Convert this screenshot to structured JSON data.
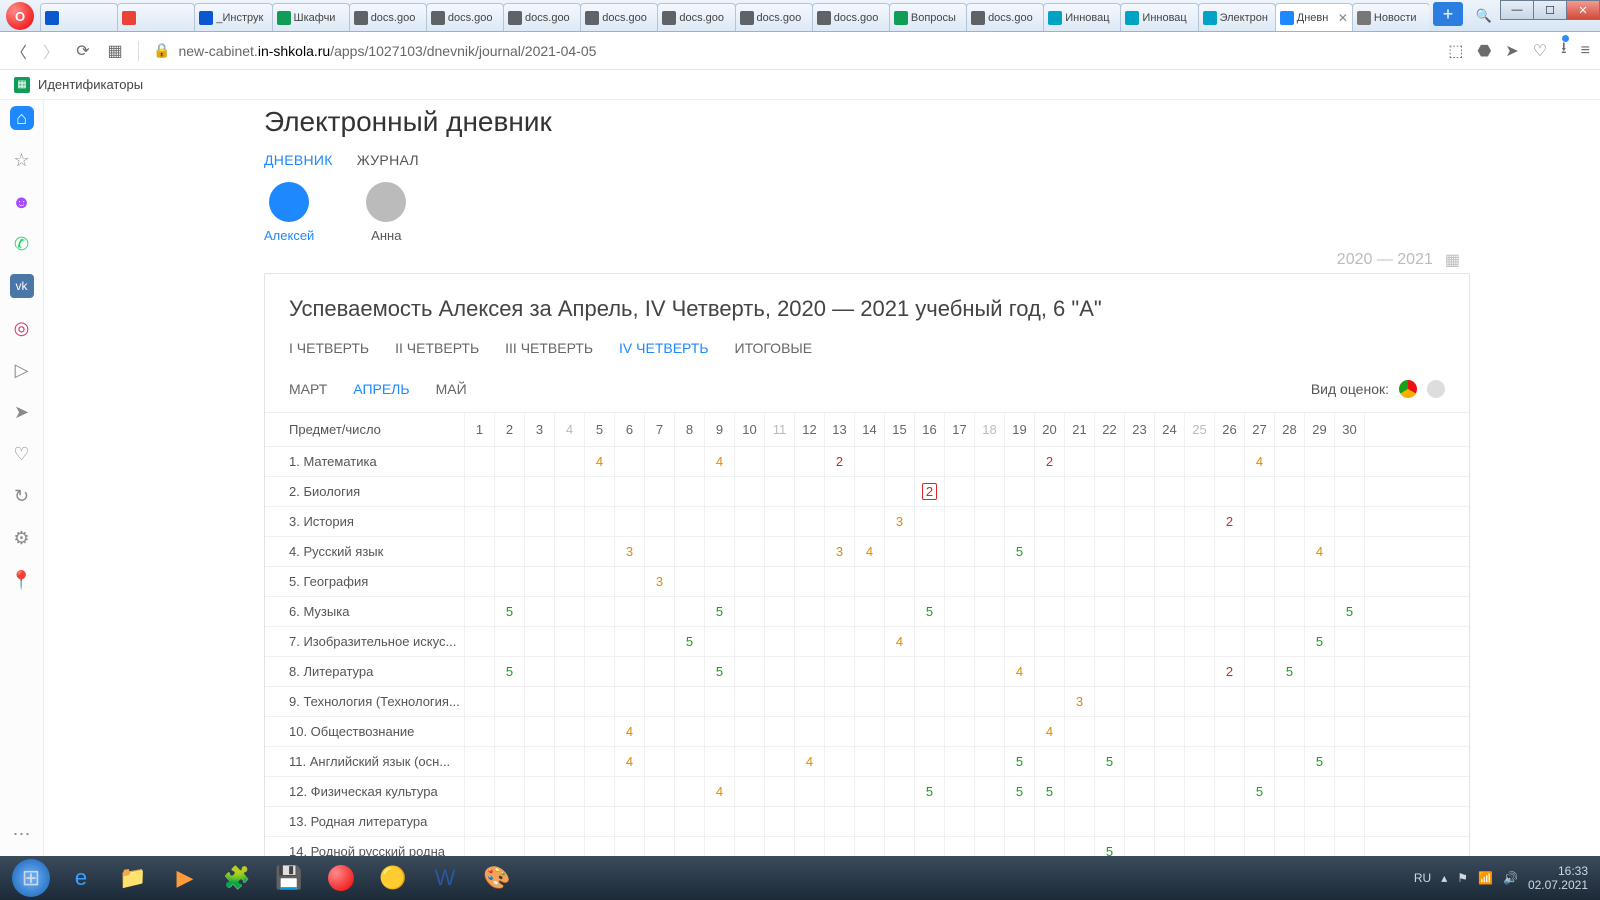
{
  "window": {
    "search_icon": "🔍",
    "min": "—",
    "max": "☐",
    "close": "✕",
    "newtab": "+"
  },
  "tabs": [
    {
      "label": "",
      "fav": "#0b57d0"
    },
    {
      "label": "",
      "fav": "#ea4335"
    },
    {
      "label": "_Инструк",
      "fav": "#0b57d0"
    },
    {
      "label": "Шкафчи",
      "fav": "#0f9d58"
    },
    {
      "label": "docs.goo",
      "fav": "#5f6368"
    },
    {
      "label": "docs.goo",
      "fav": "#5f6368"
    },
    {
      "label": "docs.goo",
      "fav": "#5f6368"
    },
    {
      "label": "docs.goo",
      "fav": "#5f6368"
    },
    {
      "label": "docs.goo",
      "fav": "#5f6368"
    },
    {
      "label": "docs.goo",
      "fav": "#5f6368"
    },
    {
      "label": "docs.goo",
      "fav": "#5f6368"
    },
    {
      "label": "Вопросы",
      "fav": "#0f9d58"
    },
    {
      "label": "docs.goo",
      "fav": "#5f6368"
    },
    {
      "label": "Инновац",
      "fav": "#00a3c4"
    },
    {
      "label": "Инновац",
      "fav": "#00a3c4"
    },
    {
      "label": "Электрон",
      "fav": "#00a3c4"
    },
    {
      "label": "Дневн",
      "fav": "#1e88ff",
      "active": true,
      "close": "✕"
    },
    {
      "label": "Новости",
      "fav": "#777"
    }
  ],
  "address": {
    "url_pre": "new-cabinet.",
    "url_host": "in-shkola.ru",
    "url_path": "/apps/1027103/dnevnik/journal/2021-04-05"
  },
  "bookmark": {
    "label": "Идентификаторы"
  },
  "page": {
    "title": "Электронный дневник",
    "tab_diary": "ДНЕВНИК",
    "tab_journal": "ЖУРНАЛ",
    "kid1": "Алексей",
    "kid2": "Анна",
    "year": "2020 — 2021",
    "card_title": "Успеваемость Алексея за Апрель, IV Четверть, 2020 — 2021 учебный год, 6 \"А\"",
    "q1": "I ЧЕТВЕРТЬ",
    "q2": "II ЧЕТВЕРТЬ",
    "q3": "III ЧЕТВЕРТЬ",
    "q4": "IV ЧЕТВЕРТЬ",
    "q5": "ИТОГОВЫЕ",
    "m1": "МАРТ",
    "m2": "АПРЕЛЬ",
    "m3": "МАЙ",
    "view_label": "Вид оценок:",
    "col_head": "Предмет/число"
  },
  "days": [
    1,
    2,
    3,
    4,
    5,
    6,
    7,
    8,
    9,
    10,
    11,
    12,
    13,
    14,
    15,
    16,
    17,
    18,
    19,
    20,
    21,
    22,
    23,
    24,
    25,
    26,
    27,
    28,
    29,
    30
  ],
  "days_off": [
    4,
    11,
    18,
    25
  ],
  "subjects": [
    {
      "n": "1. Математика",
      "g": {
        "5": 4,
        "9": 4,
        "13": 2,
        "20": 2,
        "27": 4
      }
    },
    {
      "n": "2. Биология",
      "g": {
        "16": {
          "v": 2,
          "box": true
        }
      }
    },
    {
      "n": "3. История",
      "g": {
        "15": 3,
        "26": 2
      }
    },
    {
      "n": "4. Русский язык",
      "g": {
        "6": 3,
        "13": 3,
        "14": 4,
        "19": 5,
        "29": 4
      }
    },
    {
      "n": "5. География",
      "g": {
        "7": 3
      }
    },
    {
      "n": "6. Музыка",
      "g": {
        "2": 5,
        "9": 5,
        "16": 5,
        "30": 5
      }
    },
    {
      "n": "7. Изобразительное искус...",
      "g": {
        "8": 5,
        "15": 4,
        "29": 5
      }
    },
    {
      "n": "8. Литература",
      "g": {
        "2": 5,
        "9": 5,
        "19": 4,
        "26": 2,
        "28": 5
      }
    },
    {
      "n": "9. Технология (Технология...",
      "g": {
        "21": 3
      }
    },
    {
      "n": "10. Обществознание",
      "g": {
        "6": 4,
        "20": 4
      }
    },
    {
      "n": "11. Английский язык (осн...",
      "g": {
        "6": 4,
        "12": 4,
        "19": 5,
        "22": 5,
        "29": 5
      }
    },
    {
      "n": "12. Физическая культура",
      "g": {
        "9": 4,
        "16": 5,
        "19": 5,
        "20": 5,
        "27": 5
      }
    },
    {
      "n": "13. Родная литература",
      "g": {}
    },
    {
      "n": "14. Родной русский родна",
      "g": {
        "22": 5
      }
    }
  ],
  "tray": {
    "lang": "RU",
    "time": "16:33",
    "date": "02.07.2021"
  }
}
